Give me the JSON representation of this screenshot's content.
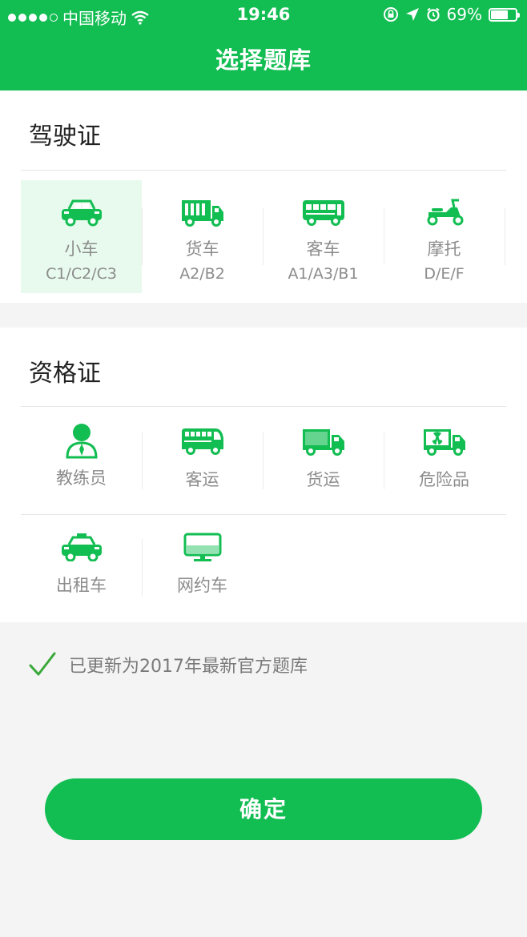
{
  "status_bar": {
    "carrier": "中国移动",
    "time": "19:46",
    "battery": "69%",
    "battery_level": 0.69
  },
  "header": {
    "title": "选择题库"
  },
  "license": {
    "title": "驾驶证",
    "items": [
      {
        "label": "小车",
        "sub": "C1/C2/C3",
        "icon": "car-icon",
        "selected": true
      },
      {
        "label": "货车",
        "sub": "A2/B2",
        "icon": "truck-icon",
        "selected": false
      },
      {
        "label": "客车",
        "sub": "A1/A3/B1",
        "icon": "bus-icon",
        "selected": false
      },
      {
        "label": "摩托",
        "sub": "D/E/F",
        "icon": "scooter-icon",
        "selected": false
      }
    ]
  },
  "qualification": {
    "title": "资格证",
    "items": [
      {
        "label": "教练员",
        "icon": "instructor-icon"
      },
      {
        "label": "客运",
        "icon": "coach-bus-icon"
      },
      {
        "label": "货运",
        "icon": "cargo-truck-icon"
      },
      {
        "label": "危险品",
        "icon": "hazmat-truck-icon"
      },
      {
        "label": "出租车",
        "icon": "taxi-icon"
      },
      {
        "label": "网约车",
        "icon": "monitor-icon"
      }
    ]
  },
  "notice": {
    "text": "已更新为2017年最新官方题库",
    "icon": "checkmark-icon"
  },
  "confirm": {
    "label": "确定"
  },
  "colors": {
    "brand": "#12bd52",
    "selected_bg": "#e7faed",
    "text_gray": "#8c8c8c"
  }
}
